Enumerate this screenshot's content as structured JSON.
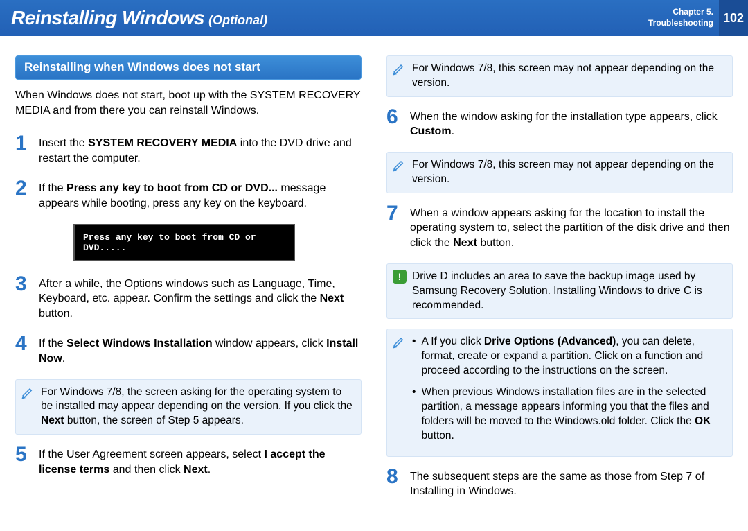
{
  "header": {
    "title_main": "Reinstalling Windows",
    "title_sub": "(Optional)",
    "chapter_line1": "Chapter 5.",
    "chapter_line2": "Troubleshooting",
    "page": "102"
  },
  "section_header": "Reinstalling when Windows does not start",
  "intro": "When Windows does not start, boot up with the SYSTEM RECOVERY MEDIA and from there you can reinstall Windows.",
  "bios_text": "Press any key to boot from CD or DVD.....",
  "steps": {
    "1": {
      "num": "1",
      "pre": "Insert the ",
      "b1": "SYSTEM RECOVERY MEDIA",
      "post": " into the DVD drive and restart the computer."
    },
    "2": {
      "num": "2",
      "pre": "If the ",
      "b1": "Press any key to boot from CD or DVD...",
      "post": " message appears while booting, press any key on the keyboard."
    },
    "3": {
      "num": "3",
      "pre": "After a while, the Options windows such as Language, Time, Keyboard, etc. appear. Confirm the settings and click the ",
      "b1": "Next",
      "post": " button."
    },
    "4": {
      "num": "4",
      "pre": "If the ",
      "b1": "Select Windows Installation",
      "mid": " window appears, click ",
      "b2": "Install Now",
      "post": "."
    },
    "5": {
      "num": "5",
      "pre": "If the User Agreement screen appears, select ",
      "b1": "I accept the license terms",
      "mid": " and then click ",
      "b2": "Next",
      "post": "."
    },
    "6": {
      "num": "6",
      "pre": "When the window asking for the installation type appears, click ",
      "b1": "Custom",
      "post": "."
    },
    "7": {
      "num": "7",
      "pre": "When a window appears asking for the location to install the operating system to, select the partition of the disk drive and then click the ",
      "b1": "Next",
      "post": " button."
    },
    "8": {
      "num": "8",
      "text": "The subsequent steps are the same as those from Step 7 of Installing in Windows."
    }
  },
  "notes": {
    "n1": {
      "pre": "For Windows 7/8, the screen asking for the operating system to be installed may appear depending on the version. If you click the ",
      "b1": "Next",
      "post": " button, the screen of Step 5 appears."
    },
    "n2": {
      "text": "For Windows 7/8, this screen may not appear depending on the version."
    },
    "n3": {
      "text": "For Windows 7/8, this screen may not appear depending on the version."
    },
    "n4": {
      "text": "Drive D includes an area to save the backup image used by Samsung Recovery Solution. Installing Windows to drive C is recommended."
    },
    "n5": {
      "b1_pre": "A If you click ",
      "b1_b": "Drive Options (Advanced)",
      "b1_post": ", you can delete, format, create or expand a partition. Click on a function and proceed according to the instructions on the screen.",
      "b2_pre": "When previous Windows installation files are in the selected partition, a message appears informing you that the files and folders will be moved to the Windows.old folder. Click the ",
      "b2_b": "OK",
      "b2_post": " button."
    }
  }
}
